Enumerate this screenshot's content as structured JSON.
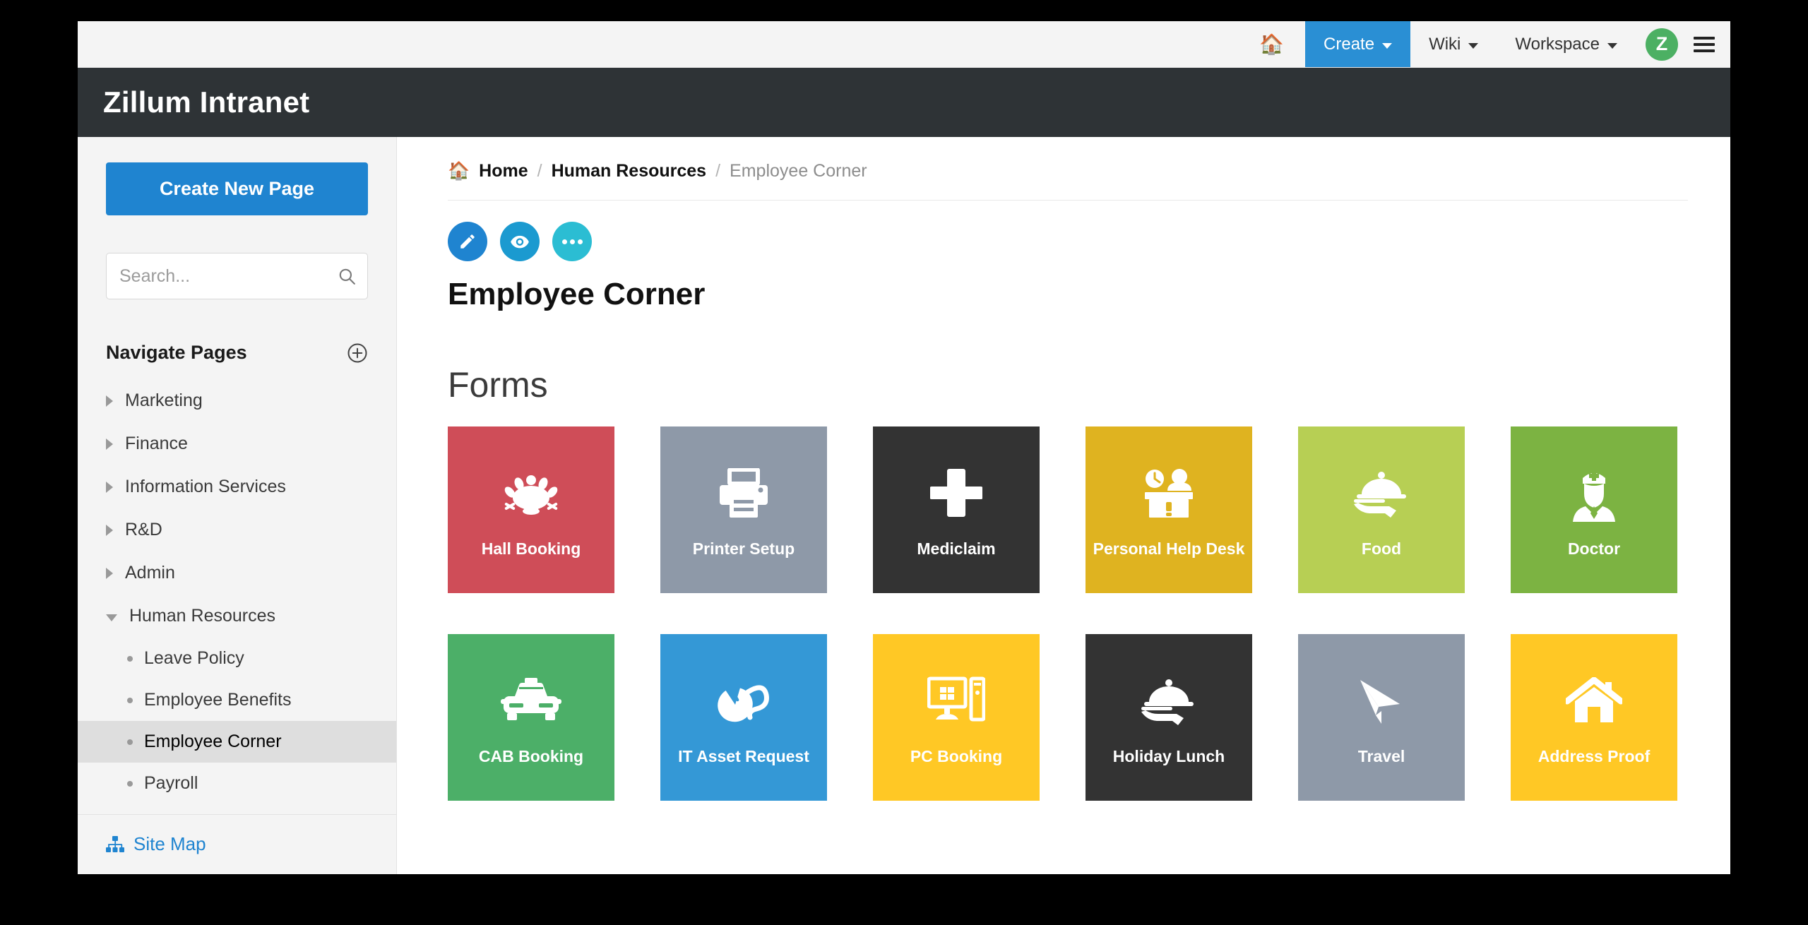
{
  "navbar": {
    "home_icon": "home-icon",
    "items": [
      {
        "label": "Create",
        "caret": true,
        "active": true
      },
      {
        "label": "Wiki",
        "caret": true,
        "active": false
      },
      {
        "label": "Workspace",
        "caret": true,
        "active": false
      }
    ],
    "avatar_initial": "Z",
    "avatar_color": "#4cb063",
    "menu_icon": "hamburger-icon",
    "active_color": "#2a8fd4"
  },
  "header": {
    "title": "Zillum Intranet",
    "background": "#2e3336"
  },
  "sidebar": {
    "create_button": "Create New Page",
    "create_button_color": "#1f84d0",
    "search": {
      "value": "",
      "placeholder": "Search..."
    },
    "navigate_title": "Navigate Pages",
    "add_icon": "plus-circle-icon",
    "tree": [
      {
        "label": "Marketing",
        "expanded": false
      },
      {
        "label": "Finance",
        "expanded": false
      },
      {
        "label": "Information Services",
        "expanded": false
      },
      {
        "label": "R&D",
        "expanded": false
      },
      {
        "label": "Admin",
        "expanded": false
      },
      {
        "label": "Human Resources",
        "expanded": true
      }
    ],
    "children": [
      {
        "label": "Leave Policy",
        "selected": false
      },
      {
        "label": "Employee Benefits",
        "selected": false
      },
      {
        "label": "Employee Corner",
        "selected": true
      },
      {
        "label": "Payroll",
        "selected": false
      }
    ],
    "site_map": {
      "label": "Site Map",
      "icon": "sitemap-icon",
      "color": "#1f84d0"
    }
  },
  "main": {
    "breadcrumb": {
      "home_icon": "home-icon",
      "home": "Home",
      "separator": "/",
      "parent": "Human Resources",
      "current": "Employee Corner"
    },
    "actions": [
      {
        "name": "edit",
        "icon": "pencil-icon",
        "color": "#1f84d0"
      },
      {
        "name": "view",
        "icon": "eye-icon",
        "color": "#1b9ad0"
      },
      {
        "name": "more",
        "icon": "ellipsis-icon",
        "color": "#2bbdd3"
      }
    ],
    "page_title": "Employee Corner",
    "section_title": "Forms",
    "tiles": [
      {
        "label": "Hall Booking",
        "color": "#cf4d58",
        "icon": "hall-icon"
      },
      {
        "label": "Printer Setup",
        "color": "#8e99a8",
        "icon": "printer-icon"
      },
      {
        "label": "Mediclaim",
        "color": "#333333",
        "icon": "medical-cross-icon"
      },
      {
        "label": "Personal Help Desk",
        "color": "#dfb320",
        "icon": "help-desk-icon"
      },
      {
        "label": "Food",
        "color": "#b7cf54",
        "icon": "food-tray-icon"
      },
      {
        "label": "Doctor",
        "color": "#7cb342",
        "icon": "doctor-icon"
      },
      {
        "label": "CAB Booking",
        "color": "#4caf68",
        "icon": "taxi-icon"
      },
      {
        "label": "IT Asset Request",
        "color": "#3498d6",
        "icon": "mouse-icon"
      },
      {
        "label": "PC Booking",
        "color": "#ffc825",
        "icon": "desktop-pc-icon"
      },
      {
        "label": "Holiday Lunch",
        "color": "#333333",
        "icon": "food-tray-icon"
      },
      {
        "label": "Travel",
        "color": "#8e99a8",
        "icon": "paper-plane-icon"
      },
      {
        "label": "Address Proof",
        "color": "#ffc825",
        "icon": "house-icon"
      }
    ]
  }
}
